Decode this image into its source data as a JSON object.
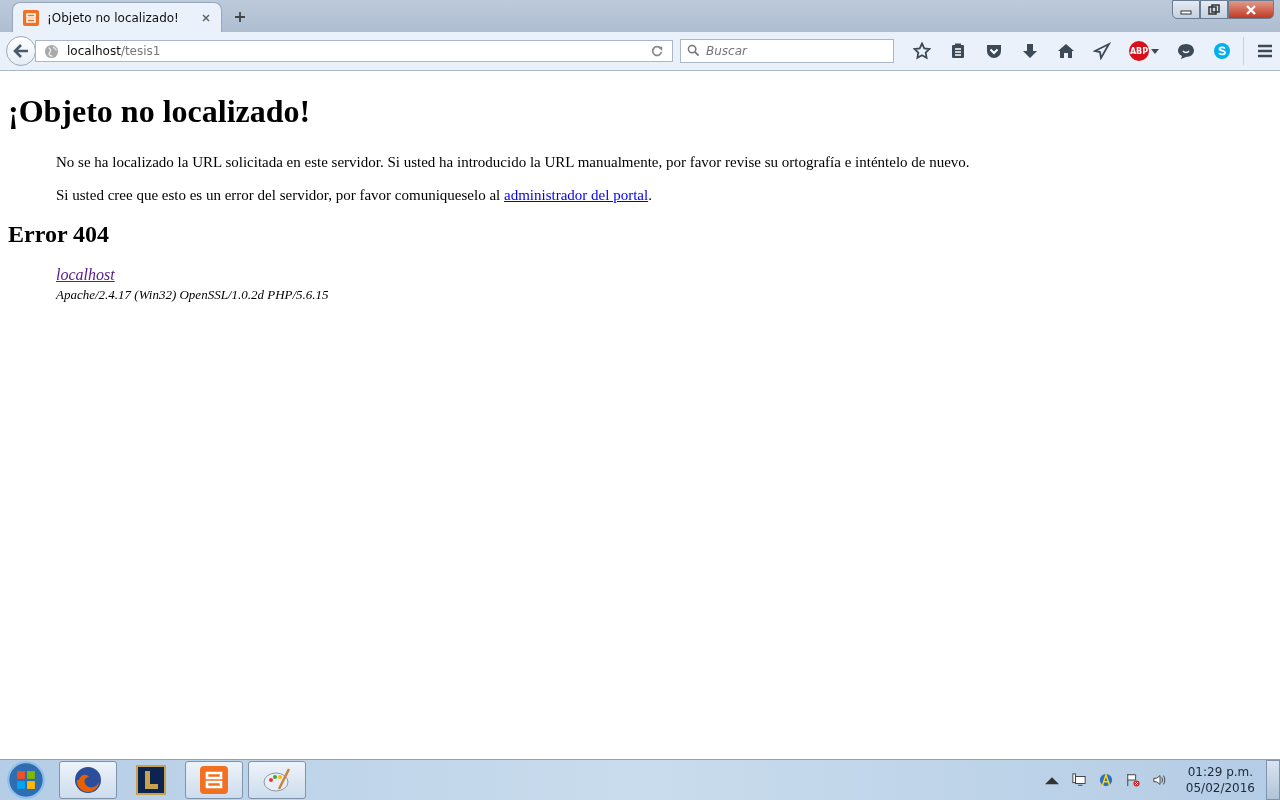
{
  "tab": {
    "title": "¡Objeto no localizado!"
  },
  "url": {
    "host": "localhost",
    "path": "/tesis1"
  },
  "search": {
    "placeholder": "Buscar"
  },
  "toolbar": {
    "abp_label": "ABP"
  },
  "page": {
    "heading": "¡Objeto no localizado!",
    "paragraph_1": "No se ha localizado la URL solicitada en este servidor. Si usted ha introducido la URL manualmente, por favor revise su ortografía e inténtelo de nuevo.",
    "paragraph_2_text": "Si usted cree que esto es un error del servidor, por favor comuniqueselo al ",
    "paragraph_2_link": "administrador del portal",
    "paragraph_2_end": ".",
    "error_heading": "Error 404",
    "server_link": "localhost",
    "server_signature": "Apache/2.4.17 (Win32) OpenSSL/1.0.2d PHP/5.6.15"
  },
  "clock": {
    "time": "01:29 p.m.",
    "date": "05/02/2016"
  }
}
